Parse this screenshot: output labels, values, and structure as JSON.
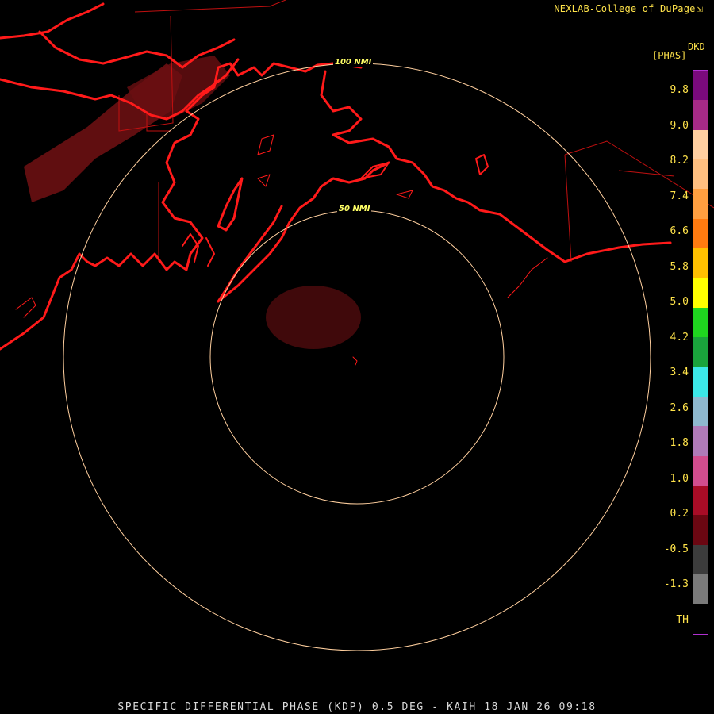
{
  "header": {
    "credit": "NEXLAB-College of DuPage",
    "corner_icon": "arrow-corner-icon"
  },
  "legend": {
    "product_code": "DKD",
    "unit": "[PHAS]",
    "ticks": [
      "9.8",
      "9.0",
      "8.2",
      "7.4",
      "6.6",
      "5.8",
      "5.0",
      "4.2",
      "3.4",
      "2.6",
      "1.8",
      "1.0",
      "0.2",
      "-0.5",
      "-1.3",
      "TH"
    ],
    "colors": [
      "#7a0a7c",
      "#a62a86",
      "#ffcfa0",
      "#ffbf80",
      "#ff9f40",
      "#ff7b10",
      "#ffc000",
      "#ffff00",
      "#1fd61f",
      "#1aa33c",
      "#3ce8e8",
      "#8fb9cf",
      "#b07bb8",
      "#d24d8e",
      "#a80c26",
      "#6b0712",
      "#3c3c3c",
      "#7a7a7a",
      "#000000"
    ]
  },
  "range_rings": {
    "labels": [
      "50 NMI",
      "100 NMI"
    ],
    "color": "#ffcf9e",
    "label_color": "#ffff66"
  },
  "map": {
    "coastline_color": "#ff1a1a",
    "echo_color": "#6a0f12"
  },
  "footer": {
    "title": "SPECIFIC DIFFERENTIAL PHASE (KDP) 0.5 DEG - KAIH 18 JAN 26 09:18"
  }
}
